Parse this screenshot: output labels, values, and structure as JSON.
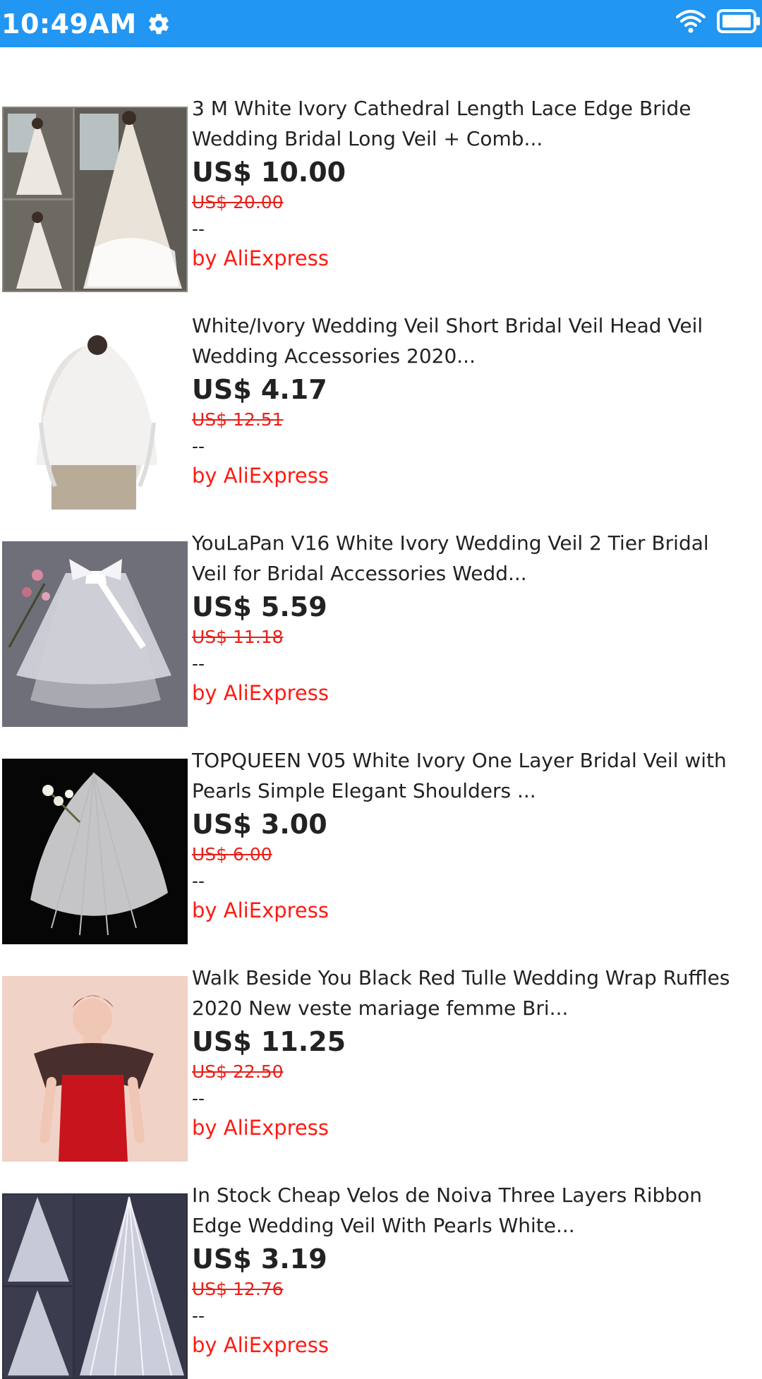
{
  "status_bar": {
    "time": "10:49AM",
    "icons": [
      "gear-icon",
      "wifi-icon",
      "battery-icon"
    ],
    "background": "#2196F3"
  },
  "products": [
    {
      "title": "3 M White Ivory Cathedral Length Lace Edge Bride\nWedding Bridal Long Veil + Comb...",
      "price": "US$ 10.00",
      "original_price": "US$ 20.00",
      "rating": "--",
      "seller": "by AliExpress"
    },
    {
      "title": "White/Ivory Wedding Veil Short Bridal Veil Head Veil\nWedding Accessories 2020...",
      "price": "US$ 4.17",
      "original_price": "US$ 12.51",
      "rating": "--",
      "seller": "by AliExpress"
    },
    {
      "title": "YouLaPan V16 White Ivory Wedding Veil 2 Tier Bridal\nVeil for Bridal Accessories Wedd...",
      "price": "US$ 5.59",
      "original_price": "US$ 11.18",
      "rating": "--",
      "seller": "by AliExpress"
    },
    {
      "title": "TOPQUEEN V05 White Ivory One Layer Bridal Veil with\nPearls Simple Elegant Shoulders ...",
      "price": "US$ 3.00",
      "original_price": "US$ 6.00",
      "rating": "--",
      "seller": "by AliExpress"
    },
    {
      "title": "Walk Beside You Black Red Tulle Wedding Wrap Ruffles\n2020 New veste mariage femme Bri...",
      "price": "US$ 11.25",
      "original_price": "US$ 22.50",
      "rating": "--",
      "seller": "by AliExpress"
    },
    {
      "title": "In Stock Cheap Velos de Noiva Three Layers Ribbon\nEdge Wedding Veil With Pearls White...",
      "price": "US$ 3.19",
      "original_price": "US$ 12.76",
      "rating": "--",
      "seller": "by AliExpress"
    }
  ]
}
